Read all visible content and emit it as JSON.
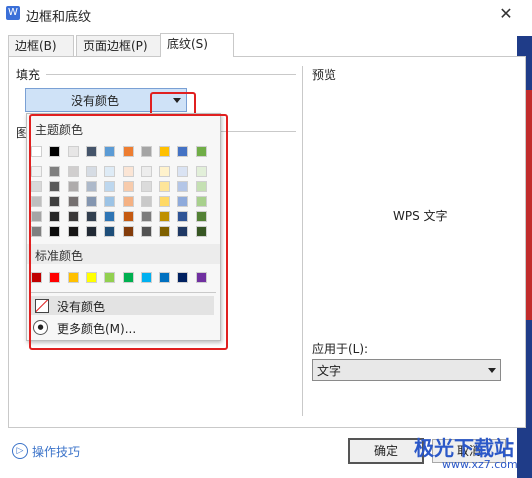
{
  "window": {
    "title": "边框和底纹",
    "app_icon": "W"
  },
  "tabs": [
    {
      "label": "边框(B)"
    },
    {
      "label": "页面边框(P)"
    },
    {
      "label": "底纹(S)",
      "active": true
    }
  ],
  "fill": {
    "section_label": "填充",
    "selected_value": "没有颜色"
  },
  "pattern": {
    "section_label_partial": "图"
  },
  "color_popup": {
    "theme_header": "主题颜色",
    "theme_top_row": [
      "#ffffff",
      "#000000",
      "#e7e6e6",
      "#44546a",
      "#5b9bd5",
      "#ed7d31",
      "#a5a5a5",
      "#ffc000",
      "#4472c4",
      "#70ad47"
    ],
    "theme_shades": [
      [
        "#f2f2f2",
        "#7f7f7f",
        "#d0cece",
        "#d6dce4",
        "#deebf6",
        "#fbe5d5",
        "#ededed",
        "#fff2cc",
        "#dae3f3",
        "#e2efd9"
      ],
      [
        "#d8d8d8",
        "#595959",
        "#aeabab",
        "#adb9ca",
        "#bdd7ee",
        "#f7cbac",
        "#dbdbdb",
        "#fee599",
        "#b4c6e7",
        "#c5e0b3"
      ],
      [
        "#bfbfbf",
        "#3f3f3f",
        "#757070",
        "#8496b0",
        "#9cc3e5",
        "#f4b183",
        "#c9c9c9",
        "#ffd965",
        "#8eaadb",
        "#a8d08d"
      ],
      [
        "#a5a5a5",
        "#262626",
        "#3a3838",
        "#323f4f",
        "#2e75b5",
        "#c55a11",
        "#7b7b7b",
        "#bf9000",
        "#2f5496",
        "#538135"
      ],
      [
        "#7f7f7f",
        "#0c0c0c",
        "#171616",
        "#222a35",
        "#1e4e79",
        "#833c0b",
        "#525252",
        "#7f6000",
        "#1f3864",
        "#375623"
      ]
    ],
    "standard_header": "标准颜色",
    "standard_colors": [
      "#c00000",
      "#ff0000",
      "#ffc000",
      "#ffff00",
      "#92d050",
      "#00b050",
      "#00b0f0",
      "#0070c0",
      "#002060",
      "#7030a0"
    ],
    "no_color_label": "没有颜色",
    "more_colors_label": "更多颜色(M)..."
  },
  "preview": {
    "section_label": "预览",
    "sample_text": "WPS 文字"
  },
  "apply_to": {
    "label": "应用于(L):",
    "value": "文字"
  },
  "footer": {
    "ops_tips": "操作技巧",
    "ok_label": "确定",
    "cancel_label": "取消"
  },
  "watermark": {
    "line1": "极光下载站",
    "line2": "www.xz7.com"
  },
  "colors": {
    "highlight_red": "#e02020",
    "combo_blue": "#cfe2f7",
    "link_blue": "#3b73c9"
  }
}
